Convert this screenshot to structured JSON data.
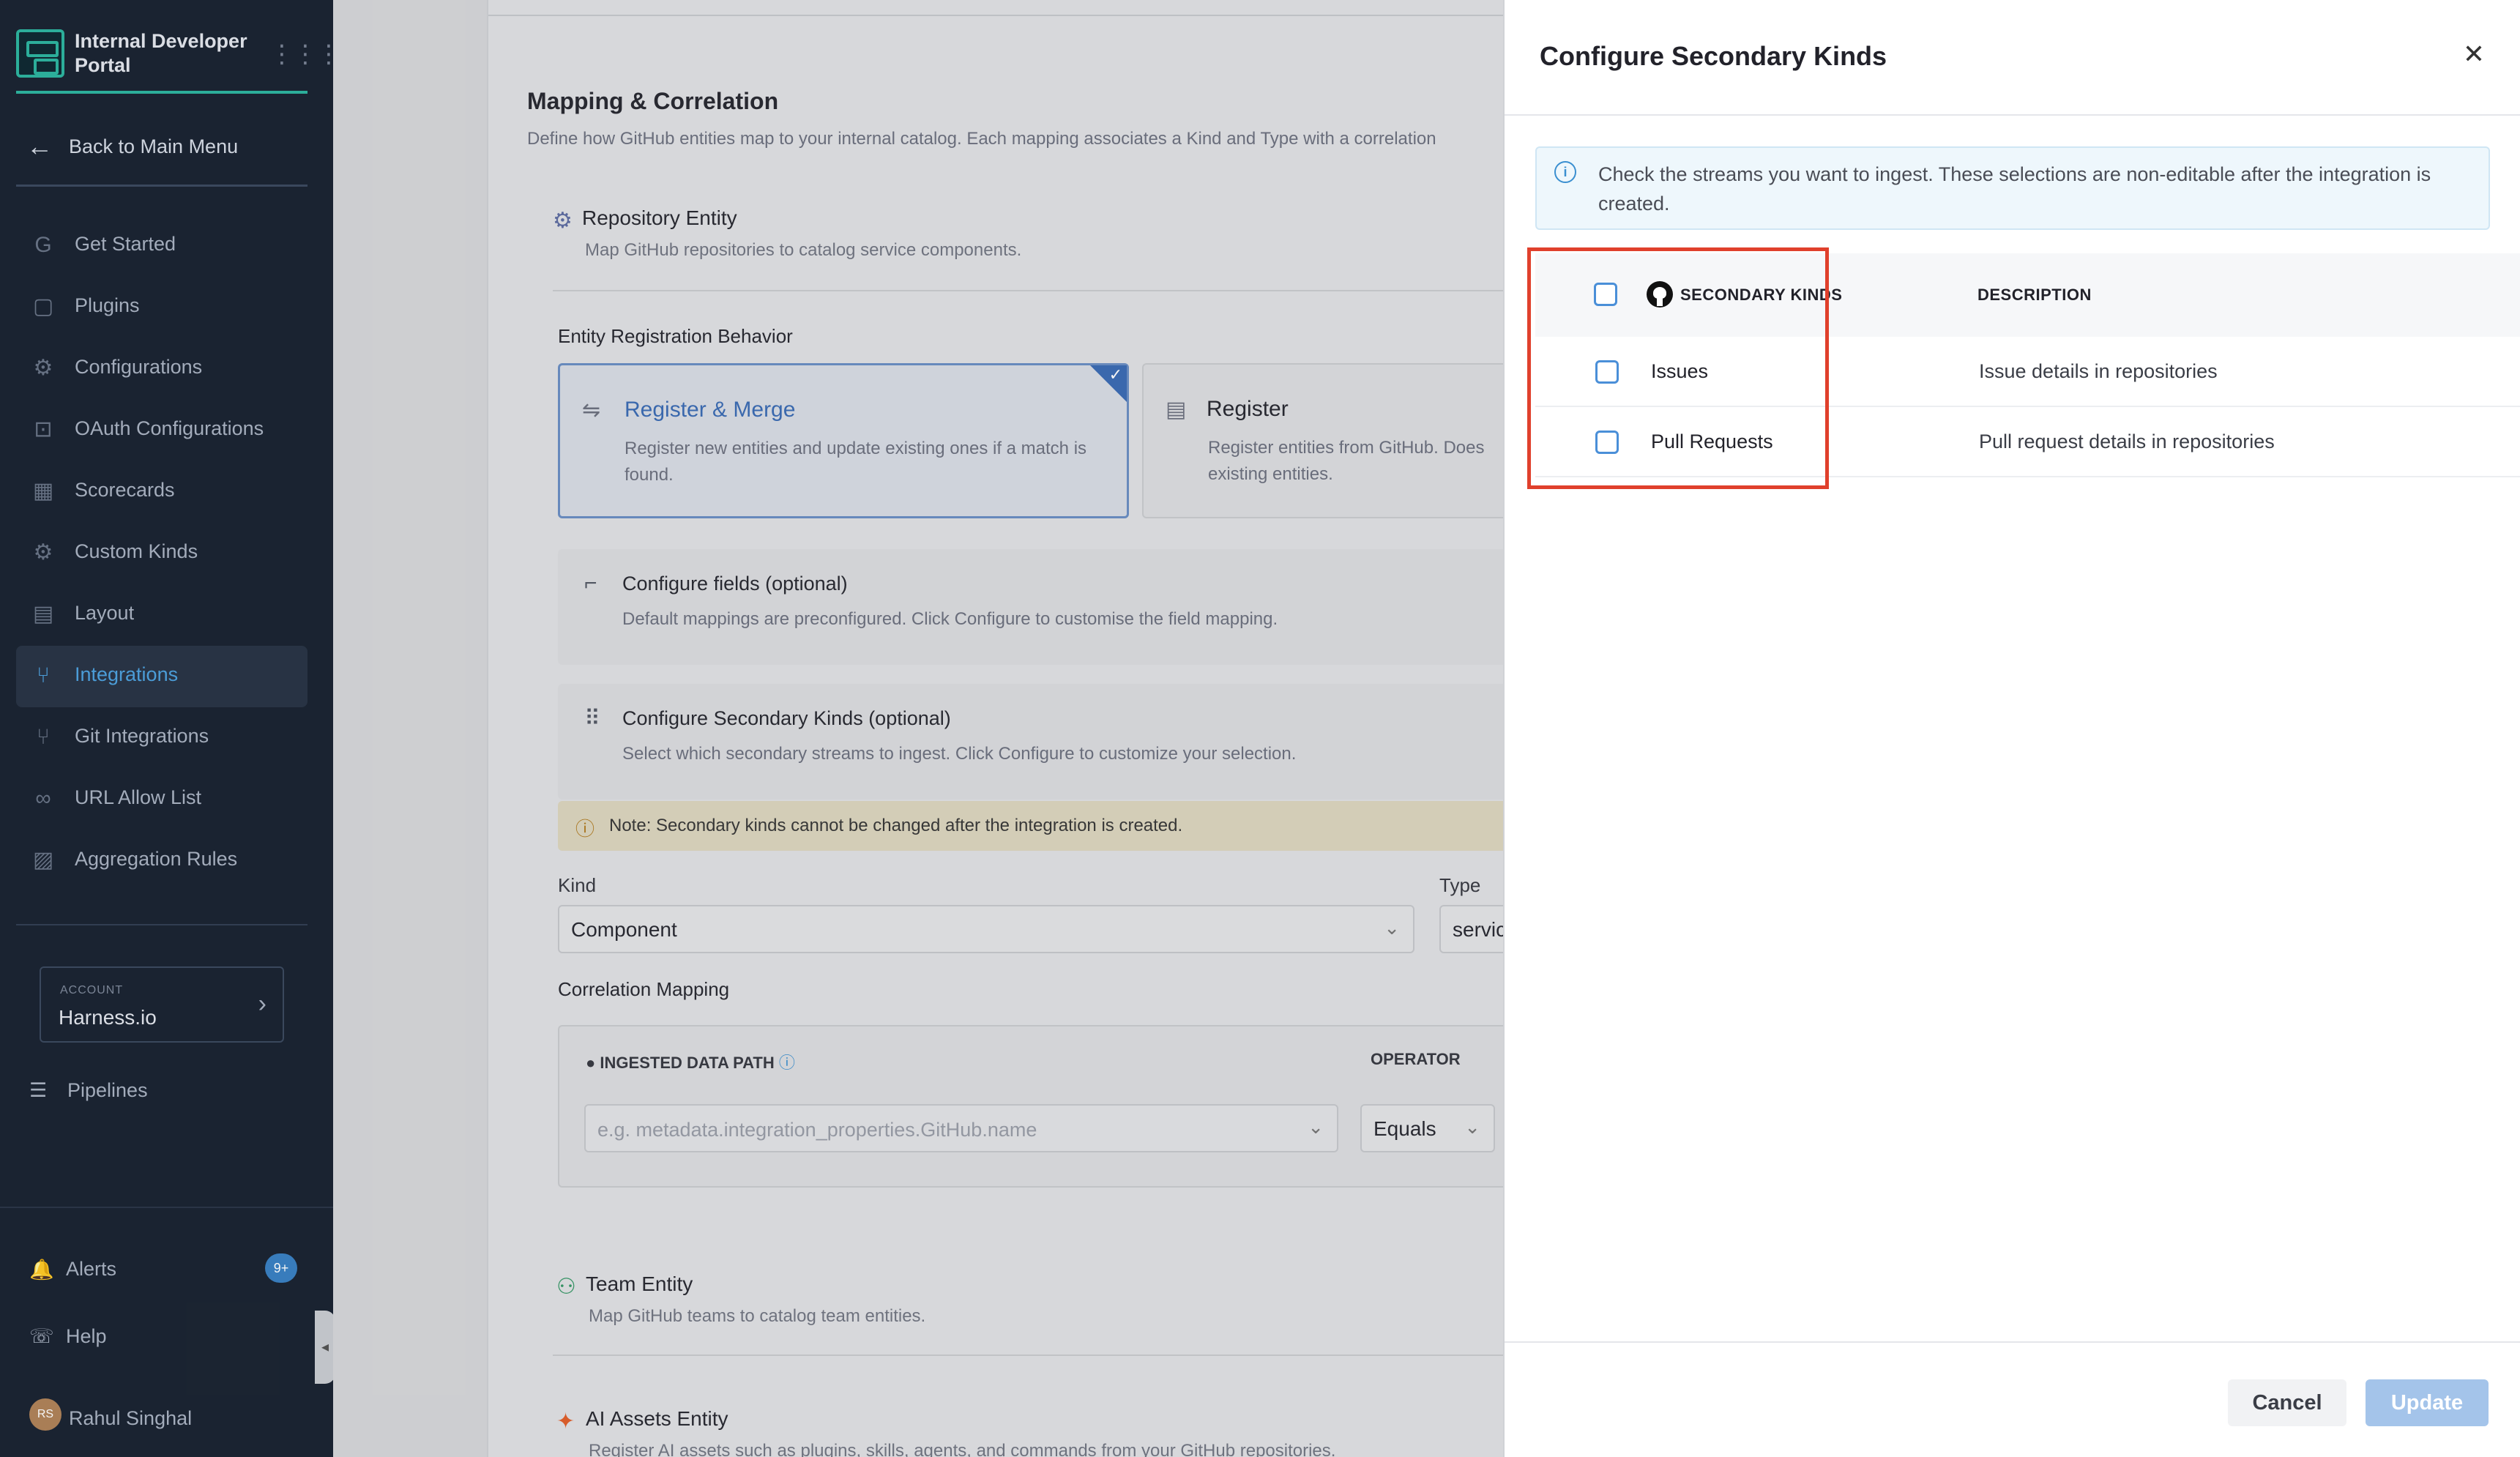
{
  "sidebar": {
    "brand_title": "Internal Developer Portal",
    "back_label": "Back to Main Menu",
    "items": [
      {
        "label": "Get Started",
        "icon": "get-started-icon",
        "glyph": "G"
      },
      {
        "label": "Plugins",
        "icon": "plugins-icon",
        "glyph": "▢"
      },
      {
        "label": "Configurations",
        "icon": "configurations-icon",
        "glyph": "⚙"
      },
      {
        "label": "OAuth Configurations",
        "icon": "lock-icon",
        "glyph": "⊡"
      },
      {
        "label": "Scorecards",
        "icon": "scorecards-icon",
        "glyph": "▦"
      },
      {
        "label": "Custom Kinds",
        "icon": "gear-icon",
        "glyph": "⚙"
      },
      {
        "label": "Layout",
        "icon": "layout-icon",
        "glyph": "▤"
      },
      {
        "label": "Integrations",
        "icon": "integrations-icon",
        "glyph": "⑂"
      },
      {
        "label": "Git Integrations",
        "icon": "git-icon",
        "glyph": "⑂"
      },
      {
        "label": "URL Allow List",
        "icon": "link-icon",
        "glyph": "∞"
      },
      {
        "label": "Aggregation Rules",
        "icon": "rules-icon",
        "glyph": "▨"
      }
    ],
    "active_item": "Integrations",
    "account": {
      "small": "ACCOUNT",
      "name": "Harness.io"
    },
    "pipelines_label": "Pipelines",
    "alerts_label": "Alerts",
    "alerts_badge": "9+",
    "help_label": "Help",
    "user_name": "Rahul Singhal",
    "user_initials": "RS"
  },
  "main": {
    "section_title": "Mapping & Correlation",
    "section_subtitle": "Define how GitHub entities map to your internal catalog. Each mapping associates a Kind and Type with a correlation",
    "repository_entity": {
      "title": "Repository Entity",
      "desc": "Map GitHub repositories to catalog service components."
    },
    "erb_title": "Entity Registration Behavior",
    "option_register_merge": {
      "title": "Register & Merge",
      "desc": "Register new entities and update existing ones if a match is found."
    },
    "option_register": {
      "title": "Register",
      "desc": "Register entities from GitHub. Does existing entities."
    },
    "configure_fields": {
      "title": "Configure fields (optional)",
      "desc": "Default mappings are preconfigured. Click Configure to customise the field mapping."
    },
    "configure_secondary": {
      "title": "Configure Secondary Kinds (optional)",
      "desc": "Select which secondary streams to ingest. Click Configure to customize your selection."
    },
    "note": "Note: Secondary kinds cannot be changed after the integration is created.",
    "kind_label": "Kind",
    "kind_value": "Component",
    "type_label": "Type",
    "type_value": "servic",
    "correlation_title": "Correlation Mapping",
    "ingested_header": "INGESTED DATA PATH",
    "operator_header": "OPERATOR",
    "ingested_placeholder": "e.g. metadata.integration_properties.GitHub.name",
    "operator_value": "Equals",
    "team_entity": {
      "title": "Team Entity",
      "desc": "Map GitHub teams to catalog team entities."
    },
    "ai_entity": {
      "title": "AI Assets Entity",
      "desc": "Register AI assets such as plugins, skills, agents, and commands from your GitHub repositories."
    }
  },
  "drawer": {
    "title": "Configure Secondary Kinds",
    "info_text": "Check the streams you want to ingest. These selections are non-editable after the integration is created.",
    "col_kinds": "SECONDARY KINDS",
    "col_description": "DESCRIPTION",
    "rows": [
      {
        "name": "Issues",
        "description": "Issue details in repositories",
        "checked": false
      },
      {
        "name": "Pull Requests",
        "description": "Pull request details in repositories",
        "checked": false
      }
    ],
    "cancel_label": "Cancel",
    "update_label": "Update"
  },
  "colors": {
    "accent": "#4a8fd8",
    "highlight": "#e0402c",
    "sidebar_bg": "#1c2533",
    "brand": "#2eb6a1"
  }
}
